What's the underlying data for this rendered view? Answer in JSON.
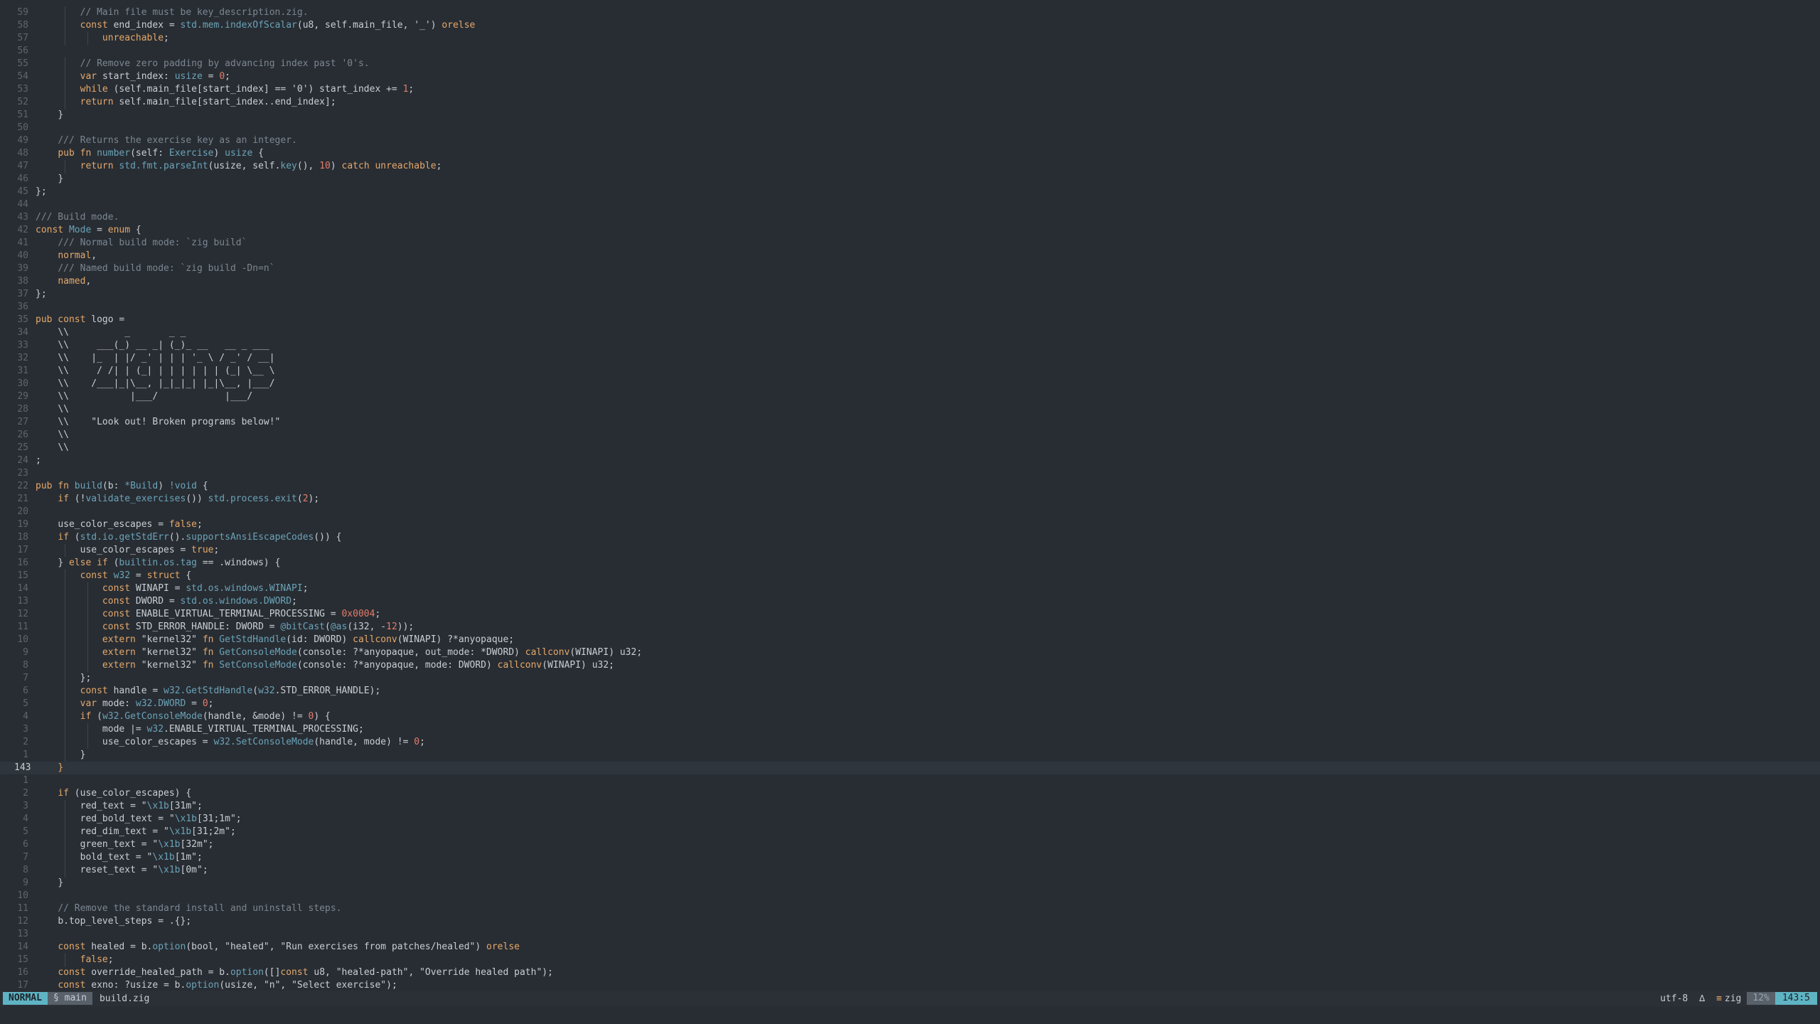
{
  "statusbar": {
    "mode": "NORMAL",
    "branch": "§ main",
    "filename": "build.zig",
    "encoding": "utf-8",
    "fileformat_icon": "∆",
    "language_icon": "≡",
    "language": "zig",
    "percent": "12%",
    "position": "143:5"
  },
  "lines": [
    {
      "n": "59",
      "i": 2,
      "t": [
        [
          "cm",
          "// Main file must be key_description.zig."
        ]
      ]
    },
    {
      "n": "58",
      "i": 2,
      "t": [
        [
          "kw",
          "const "
        ],
        [
          "",
          "end_index = "
        ],
        [
          "fn",
          "std.mem.indexOfScalar"
        ],
        [
          "",
          "(u8, self.main_file, "
        ],
        [
          "st",
          "'_'"
        ],
        [
          "",
          ") "
        ],
        [
          "kw",
          "orelse"
        ]
      ]
    },
    {
      "n": "57",
      "i": 3,
      "t": [
        [
          "kw",
          "unreachable"
        ],
        [
          "",
          ";"
        ]
      ]
    },
    {
      "n": "56",
      "i": 0,
      "t": []
    },
    {
      "n": "55",
      "i": 2,
      "t": [
        [
          "cm",
          "// Remove zero padding by advancing index past '0's."
        ]
      ]
    },
    {
      "n": "54",
      "i": 2,
      "t": [
        [
          "kw",
          "var "
        ],
        [
          "",
          "start_index: "
        ],
        [
          "ty",
          "usize"
        ],
        [
          "",
          " = "
        ],
        [
          "nu",
          "0"
        ],
        [
          "",
          ";"
        ]
      ]
    },
    {
      "n": "53",
      "i": 2,
      "t": [
        [
          "kw",
          "while "
        ],
        [
          "",
          "(self.main_file[start_index] == "
        ],
        [
          "st",
          "'0'"
        ],
        [
          "",
          ") start_index += "
        ],
        [
          "nu",
          "1"
        ],
        [
          "",
          ";"
        ]
      ]
    },
    {
      "n": "52",
      "i": 2,
      "t": [
        [
          "kw",
          "return "
        ],
        [
          "",
          "self.main_file[start_index..end_index];"
        ]
      ]
    },
    {
      "n": "51",
      "i": 1,
      "t": [
        [
          "",
          "}"
        ]
      ]
    },
    {
      "n": "50",
      "i": 0,
      "t": []
    },
    {
      "n": "49",
      "i": 1,
      "t": [
        [
          "cm",
          "/// Returns the exercise key as an integer."
        ]
      ]
    },
    {
      "n": "48",
      "i": 1,
      "t": [
        [
          "kw",
          "pub fn "
        ],
        [
          "fn",
          "number"
        ],
        [
          "",
          "(self: "
        ],
        [
          "ty",
          "Exercise"
        ],
        [
          "",
          ") "
        ],
        [
          "ty",
          "usize"
        ],
        [
          "",
          " {"
        ]
      ]
    },
    {
      "n": "47",
      "i": 2,
      "t": [
        [
          "kw",
          "return "
        ],
        [
          "fn",
          "std.fmt.parseInt"
        ],
        [
          "",
          "(usize, self."
        ],
        [
          "fn",
          "key"
        ],
        [
          "",
          "(), "
        ],
        [
          "nu",
          "10"
        ],
        [
          "",
          ") "
        ],
        [
          "kw",
          "catch unreachable"
        ],
        [
          "",
          ";"
        ]
      ]
    },
    {
      "n": "46",
      "i": 1,
      "t": [
        [
          "",
          "}"
        ]
      ]
    },
    {
      "n": "45",
      "i": 0,
      "t": [
        [
          "",
          "};"
        ]
      ]
    },
    {
      "n": "44",
      "i": 0,
      "t": []
    },
    {
      "n": "43",
      "i": 0,
      "t": [
        [
          "cm",
          "/// Build mode."
        ]
      ]
    },
    {
      "n": "42",
      "i": 0,
      "t": [
        [
          "kw",
          "const "
        ],
        [
          "ty",
          "Mode"
        ],
        [
          "",
          " = "
        ],
        [
          "kw",
          "enum"
        ],
        [
          "",
          " {"
        ]
      ]
    },
    {
      "n": "41",
      "i": 1,
      "t": [
        [
          "cm",
          "/// Normal build mode: `zig build`"
        ]
      ]
    },
    {
      "n": "40",
      "i": 1,
      "t": [
        [
          "kw",
          "normal"
        ],
        [
          "",
          ","
        ]
      ]
    },
    {
      "n": "39",
      "i": 1,
      "t": [
        [
          "cm",
          "/// Named build mode: `zig build -Dn=n`"
        ]
      ]
    },
    {
      "n": "38",
      "i": 1,
      "t": [
        [
          "kw",
          "named"
        ],
        [
          "",
          ","
        ]
      ]
    },
    {
      "n": "37",
      "i": 0,
      "t": [
        [
          "",
          "};"
        ]
      ]
    },
    {
      "n": "36",
      "i": 0,
      "t": []
    },
    {
      "n": "35",
      "i": 0,
      "t": [
        [
          "kw",
          "pub const "
        ],
        [
          "",
          "logo ="
        ]
      ]
    },
    {
      "n": "34",
      "i": 1,
      "t": [
        [
          "st",
          "\\\\          _       _ _"
        ]
      ]
    },
    {
      "n": "33",
      "i": 1,
      "t": [
        [
          "st",
          "\\\\     ___(_) __ _| (_)_ __   __ _ ___"
        ]
      ]
    },
    {
      "n": "32",
      "i": 1,
      "t": [
        [
          "st",
          "\\\\    |_  | |/ _' | | | '_ \\ / _' / __|"
        ]
      ]
    },
    {
      "n": "31",
      "i": 1,
      "t": [
        [
          "st",
          "\\\\     / /| | (_| | | | | | | (_| \\__ \\"
        ]
      ]
    },
    {
      "n": "30",
      "i": 1,
      "t": [
        [
          "st",
          "\\\\    /___|_|\\__, |_|_|_| |_|\\__, |___/"
        ]
      ]
    },
    {
      "n": "29",
      "i": 1,
      "t": [
        [
          "st",
          "\\\\           |___/            |___/"
        ]
      ]
    },
    {
      "n": "28",
      "i": 1,
      "t": [
        [
          "st",
          "\\\\"
        ]
      ]
    },
    {
      "n": "27",
      "i": 1,
      "t": [
        [
          "st",
          "\\\\    \"Look out! Broken programs below!\""
        ]
      ]
    },
    {
      "n": "26",
      "i": 1,
      "t": [
        [
          "st",
          "\\\\"
        ]
      ]
    },
    {
      "n": "25",
      "i": 1,
      "t": [
        [
          "st",
          "\\\\"
        ]
      ]
    },
    {
      "n": "24",
      "i": 0,
      "t": [
        [
          "",
          ";"
        ]
      ]
    },
    {
      "n": "23",
      "i": 0,
      "t": []
    },
    {
      "n": "22",
      "i": 0,
      "t": [
        [
          "kw",
          "pub fn "
        ],
        [
          "fn",
          "build"
        ],
        [
          "",
          "(b: "
        ],
        [
          "ty",
          "*Build"
        ],
        [
          "",
          ") "
        ],
        [
          "ty",
          "!void"
        ],
        [
          "",
          " {"
        ]
      ]
    },
    {
      "n": "21",
      "i": 1,
      "t": [
        [
          "kw",
          "if "
        ],
        [
          "",
          "(!"
        ],
        [
          "fn",
          "validate_exercises"
        ],
        [
          "",
          "()) "
        ],
        [
          "fn",
          "std.process.exit"
        ],
        [
          "",
          "("
        ],
        [
          "nu",
          "2"
        ],
        [
          "",
          ");"
        ]
      ]
    },
    {
      "n": "20",
      "i": 0,
      "t": []
    },
    {
      "n": "19",
      "i": 1,
      "t": [
        [
          "",
          "use_color_escapes = "
        ],
        [
          "kw",
          "false"
        ],
        [
          "",
          ";"
        ]
      ]
    },
    {
      "n": "18",
      "i": 1,
      "t": [
        [
          "kw",
          "if "
        ],
        [
          "",
          "("
        ],
        [
          "fn",
          "std.io.getStdErr"
        ],
        [
          "",
          "()."
        ],
        [
          "fn",
          "supportsAnsiEscapeCodes"
        ],
        [
          "",
          "()) {"
        ]
      ]
    },
    {
      "n": "17",
      "i": 2,
      "t": [
        [
          "",
          "use_color_escapes = "
        ],
        [
          "kw",
          "true"
        ],
        [
          "",
          ";"
        ]
      ]
    },
    {
      "n": "16",
      "i": 1,
      "t": [
        [
          "",
          "} "
        ],
        [
          "kw",
          "else if "
        ],
        [
          "",
          "("
        ],
        [
          "fn",
          "builtin.os.tag"
        ],
        [
          "",
          " == .windows) {"
        ]
      ]
    },
    {
      "n": "15",
      "i": 2,
      "t": [
        [
          "kw",
          "const "
        ],
        [
          "ty",
          "w32"
        ],
        [
          "",
          " = "
        ],
        [
          "kw",
          "struct"
        ],
        [
          "",
          " {"
        ]
      ]
    },
    {
      "n": "14",
      "i": 3,
      "t": [
        [
          "kw",
          "const "
        ],
        [
          "",
          "WINAPI = "
        ],
        [
          "fn",
          "std.os.windows.WINAPI"
        ],
        [
          "",
          ";"
        ]
      ]
    },
    {
      "n": "13",
      "i": 3,
      "t": [
        [
          "kw",
          "const "
        ],
        [
          "",
          "DWORD = "
        ],
        [
          "fn",
          "std.os.windows.DWORD"
        ],
        [
          "",
          ";"
        ]
      ]
    },
    {
      "n": "12",
      "i": 3,
      "t": [
        [
          "kw",
          "const "
        ],
        [
          "",
          "ENABLE_VIRTUAL_TERMINAL_PROCESSING = "
        ],
        [
          "nu",
          "0x0004"
        ],
        [
          "",
          ";"
        ]
      ]
    },
    {
      "n": "11",
      "i": 3,
      "t": [
        [
          "kw",
          "const "
        ],
        [
          "",
          "STD_ERROR_HANDLE: DWORD = "
        ],
        [
          "fn",
          "@bitCast"
        ],
        [
          "",
          "("
        ],
        [
          "fn",
          "@as"
        ],
        [
          "",
          "(i32, -"
        ],
        [
          "nu",
          "12"
        ],
        [
          "",
          "));"
        ]
      ]
    },
    {
      "n": "10",
      "i": 3,
      "t": [
        [
          "kw",
          "extern "
        ],
        [
          "st",
          "\"kernel32\" "
        ],
        [
          "kw",
          "fn "
        ],
        [
          "fn",
          "GetStdHandle"
        ],
        [
          "",
          "(id: DWORD) "
        ],
        [
          "kw",
          "callconv"
        ],
        [
          "",
          "(WINAPI) ?*anyopaque;"
        ]
      ]
    },
    {
      "n": "9",
      "i": 3,
      "t": [
        [
          "kw",
          "extern "
        ],
        [
          "st",
          "\"kernel32\" "
        ],
        [
          "kw",
          "fn "
        ],
        [
          "fn",
          "GetConsoleMode"
        ],
        [
          "",
          "(console: ?*anyopaque, out_mode: *DWORD) "
        ],
        [
          "kw",
          "callconv"
        ],
        [
          "",
          "(WINAPI) u32;"
        ]
      ]
    },
    {
      "n": "8",
      "i": 3,
      "t": [
        [
          "kw",
          "extern "
        ],
        [
          "st",
          "\"kernel32\" "
        ],
        [
          "kw",
          "fn "
        ],
        [
          "fn",
          "SetConsoleMode"
        ],
        [
          "",
          "(console: ?*anyopaque, mode: DWORD) "
        ],
        [
          "kw",
          "callconv"
        ],
        [
          "",
          "(WINAPI) u32;"
        ]
      ]
    },
    {
      "n": "7",
      "i": 2,
      "t": [
        [
          "",
          "};"
        ]
      ]
    },
    {
      "n": "6",
      "i": 2,
      "t": [
        [
          "kw",
          "const "
        ],
        [
          "",
          "handle = "
        ],
        [
          "fn",
          "w32.GetStdHandle"
        ],
        [
          "",
          "("
        ],
        [
          "fn",
          "w32"
        ],
        [
          "",
          ".STD_ERROR_HANDLE);"
        ]
      ]
    },
    {
      "n": "5",
      "i": 2,
      "t": [
        [
          "kw",
          "var "
        ],
        [
          "",
          "mode: "
        ],
        [
          "ty",
          "w32.DWORD"
        ],
        [
          "",
          " = "
        ],
        [
          "nu",
          "0"
        ],
        [
          "",
          ";"
        ]
      ]
    },
    {
      "n": "4",
      "i": 2,
      "t": [
        [
          "kw",
          "if "
        ],
        [
          "",
          "("
        ],
        [
          "fn",
          "w32.GetConsoleMode"
        ],
        [
          "",
          "(handle, &mode) != "
        ],
        [
          "nu",
          "0"
        ],
        [
          "",
          ") {"
        ]
      ]
    },
    {
      "n": "3",
      "i": 3,
      "t": [
        [
          "",
          "mode |= "
        ],
        [
          "fn",
          "w32"
        ],
        [
          "",
          ".ENABLE_VIRTUAL_TERMINAL_PROCESSING;"
        ]
      ]
    },
    {
      "n": "2",
      "i": 3,
      "t": [
        [
          "",
          "use_color_escapes = "
        ],
        [
          "fn",
          "w32.SetConsoleMode"
        ],
        [
          "",
          "(handle, mode) != "
        ],
        [
          "nu",
          "0"
        ],
        [
          "",
          ";"
        ]
      ]
    },
    {
      "n": "1",
      "i": 2,
      "t": [
        [
          "",
          "}"
        ]
      ]
    },
    {
      "n": "143",
      "i": 1,
      "cur": true,
      "t": [
        [
          "kw",
          "}"
        ]
      ]
    },
    {
      "n": "1",
      "i": 0,
      "t": []
    },
    {
      "n": "2",
      "i": 1,
      "t": [
        [
          "kw",
          "if "
        ],
        [
          "",
          "(use_color_escapes) {"
        ]
      ]
    },
    {
      "n": "3",
      "i": 2,
      "t": [
        [
          "",
          "red_text = "
        ],
        [
          "st",
          "\""
        ],
        [
          "es",
          "\\x1b"
        ],
        [
          "st",
          "[31m\""
        ],
        [
          "",
          ";"
        ]
      ]
    },
    {
      "n": "4",
      "i": 2,
      "t": [
        [
          "",
          "red_bold_text = "
        ],
        [
          "st",
          "\""
        ],
        [
          "es",
          "\\x1b"
        ],
        [
          "st",
          "[31;1m\""
        ],
        [
          "",
          ";"
        ]
      ]
    },
    {
      "n": "5",
      "i": 2,
      "t": [
        [
          "",
          "red_dim_text = "
        ],
        [
          "st",
          "\""
        ],
        [
          "es",
          "\\x1b"
        ],
        [
          "st",
          "[31;2m\""
        ],
        [
          "",
          ";"
        ]
      ]
    },
    {
      "n": "6",
      "i": 2,
      "t": [
        [
          "",
          "green_text = "
        ],
        [
          "st",
          "\""
        ],
        [
          "es",
          "\\x1b"
        ],
        [
          "st",
          "[32m\""
        ],
        [
          "",
          ";"
        ]
      ]
    },
    {
      "n": "7",
      "i": 2,
      "t": [
        [
          "",
          "bold_text = "
        ],
        [
          "st",
          "\""
        ],
        [
          "es",
          "\\x1b"
        ],
        [
          "st",
          "[1m\""
        ],
        [
          "",
          ";"
        ]
      ]
    },
    {
      "n": "8",
      "i": 2,
      "t": [
        [
          "",
          "reset_text = "
        ],
        [
          "st",
          "\""
        ],
        [
          "es",
          "\\x1b"
        ],
        [
          "st",
          "[0m\""
        ],
        [
          "",
          ";"
        ]
      ]
    },
    {
      "n": "9",
      "i": 1,
      "t": [
        [
          "",
          "}"
        ]
      ]
    },
    {
      "n": "10",
      "i": 0,
      "t": []
    },
    {
      "n": "11",
      "i": 1,
      "t": [
        [
          "cm",
          "// Remove the standard install and uninstall steps."
        ]
      ]
    },
    {
      "n": "12",
      "i": 1,
      "t": [
        [
          "",
          "b.top_level_steps = .{};"
        ]
      ]
    },
    {
      "n": "13",
      "i": 0,
      "t": []
    },
    {
      "n": "14",
      "i": 1,
      "t": [
        [
          "kw",
          "const "
        ],
        [
          "",
          "healed = b."
        ],
        [
          "fn",
          "option"
        ],
        [
          "",
          "(bool, "
        ],
        [
          "st",
          "\"healed\""
        ],
        [
          "",
          ", "
        ],
        [
          "st",
          "\"Run exercises from patches/healed\""
        ],
        [
          "",
          ") "
        ],
        [
          "kw",
          "orelse"
        ]
      ]
    },
    {
      "n": "15",
      "i": 2,
      "t": [
        [
          "kw",
          "false"
        ],
        [
          "",
          ";"
        ]
      ]
    },
    {
      "n": "16",
      "i": 1,
      "t": [
        [
          "kw",
          "const "
        ],
        [
          "",
          "override_healed_path = b."
        ],
        [
          "fn",
          "option"
        ],
        [
          "",
          "([]"
        ],
        [
          "kw",
          "const "
        ],
        [
          "",
          "u8, "
        ],
        [
          "st",
          "\"healed-path\""
        ],
        [
          "",
          ", "
        ],
        [
          "st",
          "\"Override healed path\""
        ],
        [
          "",
          ");"
        ]
      ]
    },
    {
      "n": "17",
      "i": 1,
      "t": [
        [
          "kw",
          "const "
        ],
        [
          "",
          "exno: ?usize = b."
        ],
        [
          "fn",
          "option"
        ],
        [
          "",
          "(usize, "
        ],
        [
          "st",
          "\"n\""
        ],
        [
          "",
          ", "
        ],
        [
          "st",
          "\"Select exercise\""
        ],
        [
          "",
          ");"
        ]
      ]
    }
  ]
}
